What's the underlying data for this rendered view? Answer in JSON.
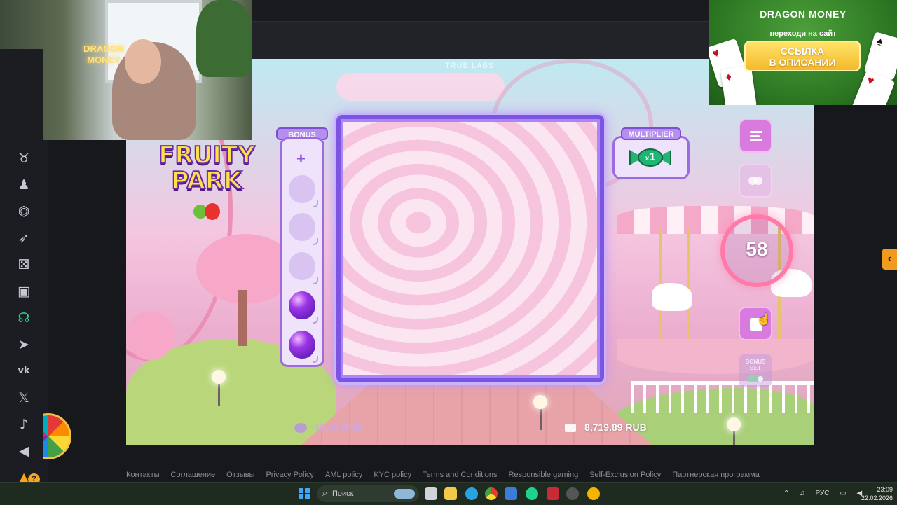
{
  "game": {
    "provider": "TRUE LABS",
    "logo_line1": "FRUITY",
    "logo_line2": "PARK",
    "bonus_label": "BONUS",
    "bonus_plus": "+",
    "bonus_slots": [
      "empty",
      "empty",
      "empty",
      "balloon",
      "balloon"
    ],
    "multiplier_label": "MULTIPLIER",
    "multiplier_prefix": "x",
    "multiplier_value": "1",
    "spin_count": "58",
    "bonus_bet_label_1": "BONUS",
    "bonus_bet_label_2": "BET",
    "bet": "40.00 RUB",
    "balance": "8,719.89 RUB",
    "colors": {
      "accent": "#9c6be0",
      "button": "#d97adf",
      "ring": "#ff7aa8"
    }
  },
  "webcam": {
    "neon_line1": "DRAGON",
    "neon_line2": "MONEY"
  },
  "ad": {
    "brand": "DRAGON MONEY",
    "subtitle": "переходи на сайт",
    "button_line1": "ССЫЛКА",
    "button_line2": "В ОПИСАНИИ"
  },
  "sidebar": {
    "icons": [
      "bull-icon",
      "user-icon",
      "controller-icon",
      "rocket-icon",
      "dice-icon",
      "safe-icon",
      "support-icon",
      "telegram-icon",
      "vk-icon",
      "x-icon",
      "bell-icon",
      "volume-icon"
    ],
    "badge": "?"
  },
  "footer": {
    "links": [
      "Контакты",
      "Соглашение",
      "Отзывы",
      "Privacy Policy",
      "AML policy",
      "KYC policy",
      "Terms and Conditions",
      "Responsible gaming",
      "Self-Exclusion Policy",
      "Партнерская программа"
    ]
  },
  "taskbar": {
    "search_placeholder": "Поиск",
    "lang": "РУС",
    "time": "23:09",
    "date": "22.02.2026"
  }
}
